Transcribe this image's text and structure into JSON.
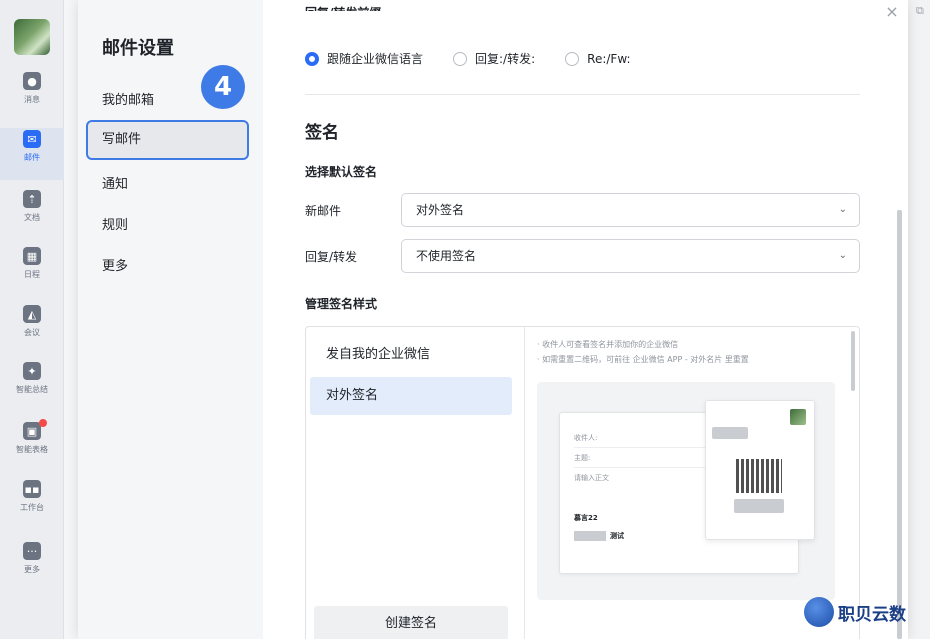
{
  "rail": {
    "items": [
      {
        "label": "消息",
        "icon": "chat-icon",
        "glyph": "●"
      },
      {
        "label": "邮件",
        "icon": "mail-icon",
        "glyph": "✉",
        "active": true
      },
      {
        "label": "文档",
        "icon": "doc-icon",
        "glyph": "⇡"
      },
      {
        "label": "日程",
        "icon": "calendar-icon",
        "glyph": "▦"
      },
      {
        "label": "会议",
        "icon": "meeting-icon",
        "glyph": "◭"
      },
      {
        "label": "智能总结",
        "icon": "sparkle-icon",
        "glyph": "✦"
      },
      {
        "label": "智能表格",
        "icon": "sheet-icon",
        "glyph": "▣"
      },
      {
        "label": "工作台",
        "icon": "grid-icon",
        "glyph": "▪▪"
      },
      {
        "label": "更多",
        "icon": "more-icon",
        "glyph": "···"
      }
    ]
  },
  "nav": {
    "title": "邮件设置",
    "items": [
      "我的邮箱",
      "写邮件",
      "通知",
      "规则",
      "更多"
    ],
    "active_index": 1,
    "step_badge": "4"
  },
  "reply_prefix": {
    "heading": "回复/转发前缀",
    "options": [
      "跟随企业微信语言",
      "回复:/转发:",
      "Re:/Fw:"
    ],
    "selected_index": 0
  },
  "signature": {
    "heading": "签名",
    "default_heading": "选择默认签名",
    "new_mail_label": "新邮件",
    "new_mail_value": "对外签名",
    "reply_label": "回复/转发",
    "reply_value": "不使用签名",
    "manage_heading": "管理签名样式",
    "list": [
      "发自我的企业微信",
      "对外签名"
    ],
    "active_index": 1,
    "create_button": "创建签名",
    "tips": [
      "· 收件人可查看签名并添加你的企业微信",
      "· 如需重置二维码，可前往 企业微信 APP - 对外名片 里重置"
    ],
    "preview": {
      "to_label": "收件人:",
      "subject_label": "主题:",
      "body_placeholder": "请输入正文",
      "sender_name": "慕言22",
      "sign_text": "测试"
    }
  },
  "watermark": {
    "text": "职贝云数"
  },
  "colors": {
    "accent": "#2b6cf6",
    "badge": "#3f7be6"
  }
}
